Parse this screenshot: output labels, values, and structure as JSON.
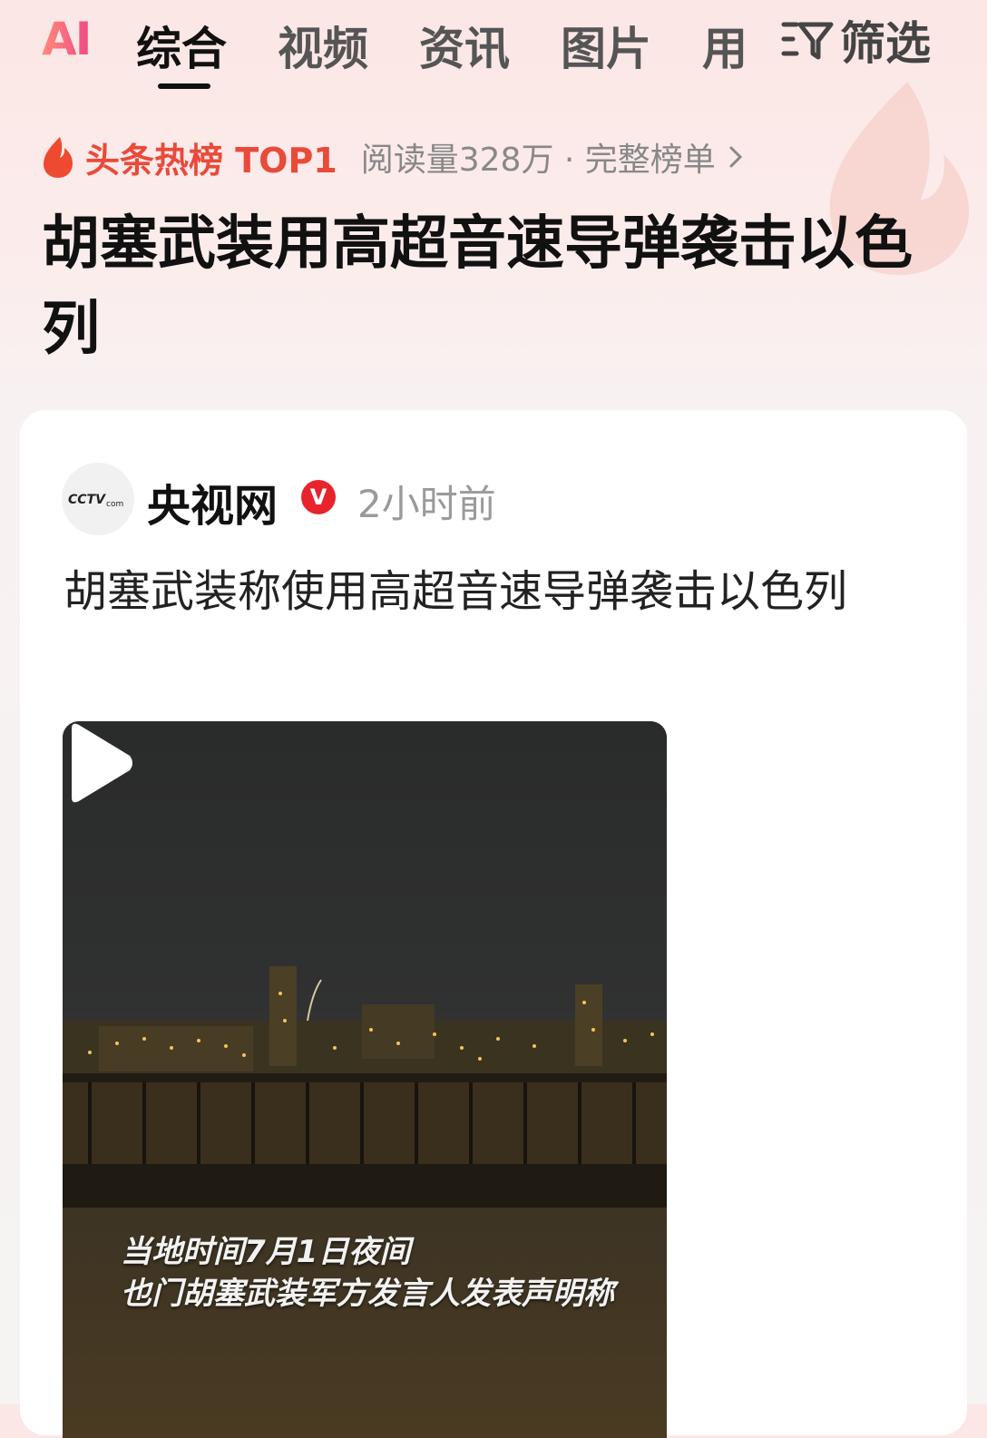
{
  "tabs": {
    "ai_label": "AI",
    "items": [
      "综合",
      "视频",
      "资讯",
      "图片",
      "用"
    ],
    "filter_label": "筛选"
  },
  "hot": {
    "label": "头条热榜 TOP1",
    "meta": "阅读量328万 · 完整榜单"
  },
  "headline": "胡塞武装用高超音速导弹袭击以色列",
  "card": {
    "source_name": "央视网",
    "verified_mark": "V",
    "time": "2小时前",
    "title": "胡塞武装称使用高超音速导弹袭击以色列",
    "video_subtitle_line1": "当地时间7月1日夜间",
    "video_subtitle_line2": "也门胡塞武装军方发言人发表声明称"
  },
  "logo_text": "CCTV.com",
  "colors": {
    "accent_red": "#e94a3a",
    "verified_red": "#e8232c"
  },
  "icons": [
    "flame-icon",
    "chevron-right-icon",
    "filter-icon",
    "play-icon",
    "verified-icon"
  ]
}
